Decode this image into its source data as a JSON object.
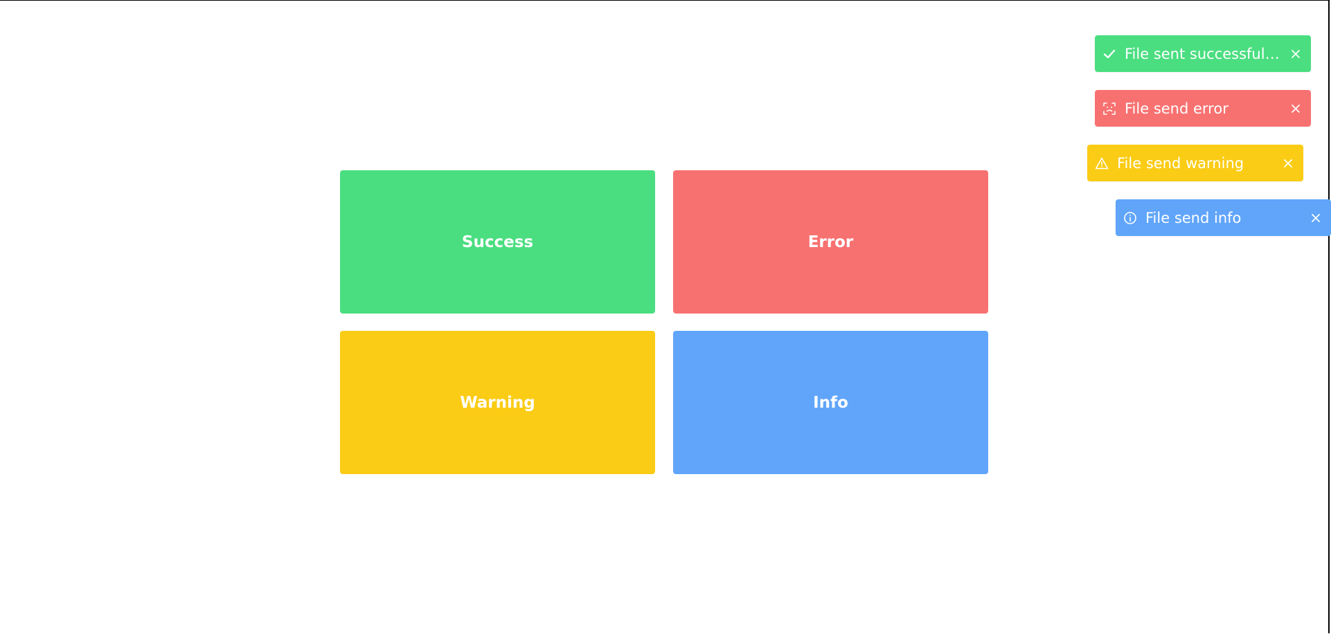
{
  "buttons": {
    "success": "Success",
    "error": "Error",
    "warning": "Warning",
    "info": "Info"
  },
  "toasts": [
    {
      "type": "success",
      "text": "File sent successfully...",
      "icon": "check-icon",
      "color": "#4ade80"
    },
    {
      "type": "error",
      "text": "File send error",
      "icon": "error-face-icon",
      "color": "#f87171"
    },
    {
      "type": "warning",
      "text": "File send warning",
      "icon": "warning-triangle-icon",
      "color": "#facc15"
    },
    {
      "type": "info",
      "text": "File send info",
      "icon": "info-circle-icon",
      "color": "#60a5fa"
    }
  ],
  "colors": {
    "success": "#4ade80",
    "error": "#f87171",
    "warning": "#facc15",
    "info": "#60a5fa",
    "text": "#ffffff"
  }
}
